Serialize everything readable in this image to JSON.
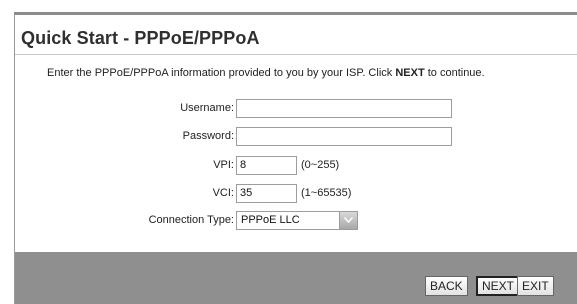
{
  "page": {
    "title": "Quick Start - PPPoE/PPPoA",
    "intro_prefix": "Enter the PPPoE/PPPoA information provided to you by your ISP. Click ",
    "intro_emphasis": "NEXT",
    "intro_suffix": " to continue."
  },
  "form": {
    "username": {
      "label": "Username:",
      "value": ""
    },
    "password": {
      "label": "Password:",
      "value": ""
    },
    "vpi": {
      "label": "VPI:",
      "value": "8",
      "hint": "(0~255)"
    },
    "vci": {
      "label": "VCI:",
      "value": "35",
      "hint": "(1~65535)"
    },
    "connection_type": {
      "label": "Connection Type:",
      "value": "PPPoE LLC"
    }
  },
  "buttons": {
    "back": "BACK",
    "next": "NEXT",
    "exit": "EXIT"
  },
  "colors": {
    "footer": "#8f8f8f",
    "title": "#2f2f2f"
  }
}
